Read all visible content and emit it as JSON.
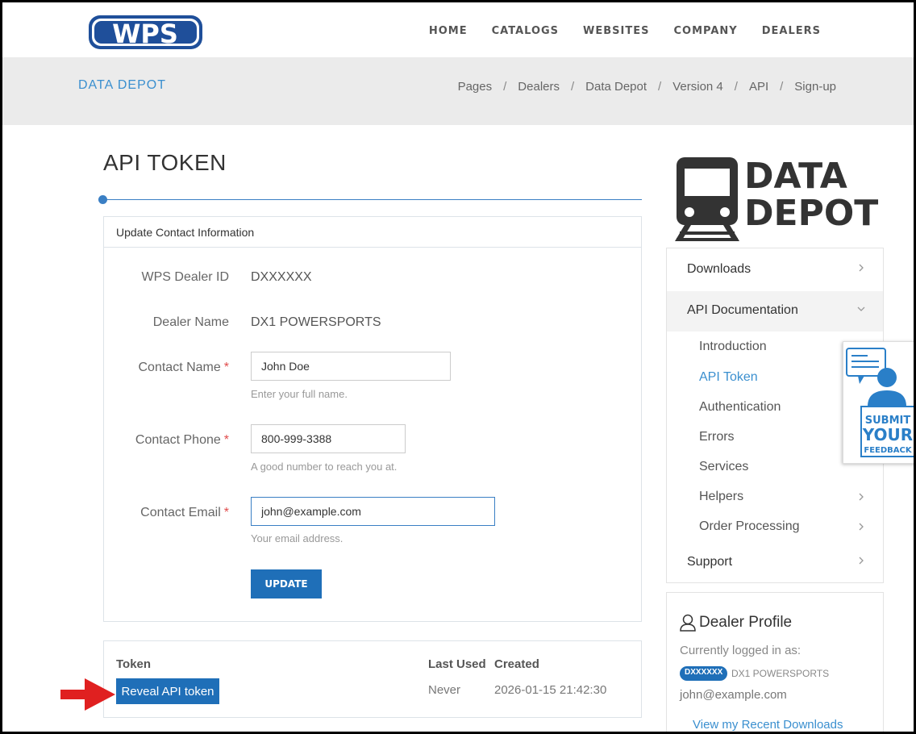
{
  "header": {
    "logo_text": "WPS",
    "nav": [
      "HOME",
      "CATALOGS",
      "WEBSITES",
      "COMPANY",
      "DEALERS"
    ]
  },
  "subheader": {
    "title": "DATA DEPOT",
    "breadcrumb": [
      "Pages",
      "Dealers",
      "Data Depot",
      "Version 4",
      "API",
      "Sign-up"
    ]
  },
  "page": {
    "title": "API TOKEN"
  },
  "contact_form": {
    "heading": "Update Contact Information",
    "dealer_id_label": "WPS Dealer ID",
    "dealer_id_value": "DXXXXXX",
    "dealer_name_label": "Dealer Name",
    "dealer_name_value": "DX1 POWERSPORTS",
    "contact_name_label": "Contact Name",
    "contact_name_value": "John Doe",
    "contact_name_help": "Enter your full name.",
    "contact_phone_label": "Contact Phone",
    "contact_phone_value": "800-999-3388",
    "contact_phone_help": "A good number to reach you at.",
    "contact_email_label": "Contact Email",
    "contact_email_value": "john@example.com",
    "contact_email_help": "Your email address.",
    "required_mark": "*",
    "update_label": "UPDATE"
  },
  "token_table": {
    "headers": [
      "Token",
      "Last Used",
      "Created"
    ],
    "reveal_label": "Reveal API token",
    "last_used": "Never",
    "created": "2026-01-15 21:42:30"
  },
  "sidebar": {
    "logo_line1": "DATA",
    "logo_line2": "DEPOT",
    "menu": [
      {
        "label": "Downloads"
      },
      {
        "label": "API Documentation"
      },
      {
        "label": "Support"
      }
    ],
    "sub_items": [
      "Introduction",
      "API Token",
      "Authentication",
      "Errors",
      "Services",
      "Helpers",
      "Order Processing"
    ],
    "feedback_text": [
      "SUBMIT",
      "YOUR",
      "FEEDBACK"
    ]
  },
  "profile": {
    "title": "Dealer Profile",
    "logged_in_text": "Currently logged in as:",
    "badge": "DXXXXXX",
    "dealer": "DX1 POWERSPORTS",
    "email": "john@example.com",
    "recent_link": "View my Recent Downloads"
  },
  "colors": {
    "brand_blue": "#1f6fb8",
    "link_blue": "#3a8fcf",
    "arrow_red": "#e02020"
  },
  "icons": [
    "chevron-right-icon",
    "chevron-down-icon",
    "user-icon",
    "train-icon",
    "feedback-icon",
    "red-arrow-icon"
  ]
}
